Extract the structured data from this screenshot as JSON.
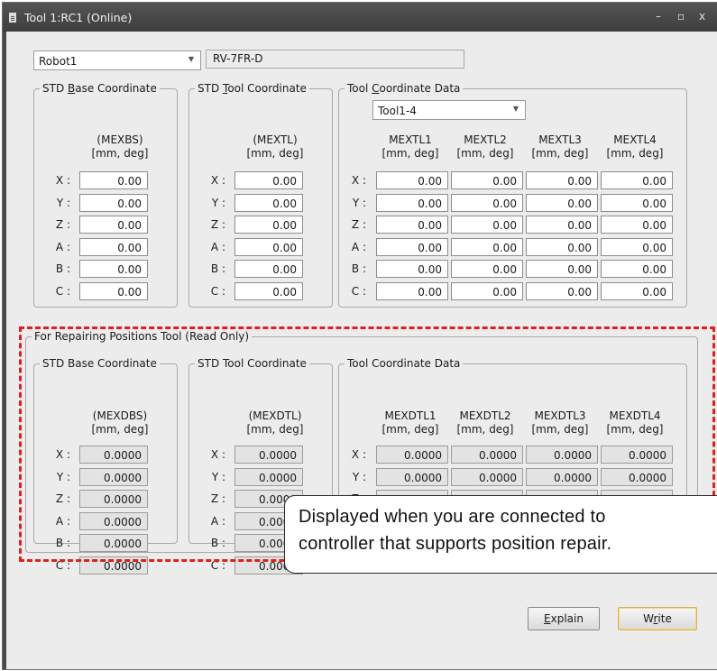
{
  "window": {
    "title": "Tool 1:RC1 (Online)",
    "minimize": "–",
    "maximize": "▫",
    "close": "x"
  },
  "robot_select": {
    "value": "Robot1",
    "model": "RV-7FR-D"
  },
  "std_base": {
    "group_pre": "STD ",
    "group_u": "B",
    "group_post": "ase Coordinate",
    "var": "(MEXBS)",
    "unit": "[mm, deg]",
    "rows": [
      {
        "axis": "X :",
        "value": "0.00"
      },
      {
        "axis": "Y :",
        "value": "0.00"
      },
      {
        "axis": "Z :",
        "value": "0.00"
      },
      {
        "axis": "A :",
        "value": "0.00"
      },
      {
        "axis": "B :",
        "value": "0.00"
      },
      {
        "axis": "C :",
        "value": "0.00"
      }
    ]
  },
  "std_tool": {
    "group_pre": "STD ",
    "group_u": "T",
    "group_post": "ool Coordinate",
    "var": "(MEXTL)",
    "unit": "[mm, deg]",
    "rows": [
      {
        "axis": "X :",
        "value": "0.00"
      },
      {
        "axis": "Y :",
        "value": "0.00"
      },
      {
        "axis": "Z :",
        "value": "0.00"
      },
      {
        "axis": "A :",
        "value": "0.00"
      },
      {
        "axis": "B :",
        "value": "0.00"
      },
      {
        "axis": "C :",
        "value": "0.00"
      }
    ]
  },
  "tool_data": {
    "group_pre": "Tool ",
    "group_u": "C",
    "group_post": "oordinate Data",
    "select_value": "Tool1-4",
    "columns": [
      {
        "name": "MEXTL1",
        "unit": "[mm, deg]"
      },
      {
        "name": "MEXTL2",
        "unit": "[mm, deg]"
      },
      {
        "name": "MEXTL3",
        "unit": "[mm, deg]"
      },
      {
        "name": "MEXTL4",
        "unit": "[mm, deg]"
      }
    ],
    "axes": [
      "X :",
      "Y :",
      "Z :",
      "A :",
      "B :",
      "C :"
    ],
    "values": [
      [
        "0.00",
        "0.00",
        "0.00",
        "0.00"
      ],
      [
        "0.00",
        "0.00",
        "0.00",
        "0.00"
      ],
      [
        "0.00",
        "0.00",
        "0.00",
        "0.00"
      ],
      [
        "0.00",
        "0.00",
        "0.00",
        "0.00"
      ],
      [
        "0.00",
        "0.00",
        "0.00",
        "0.00"
      ],
      [
        "0.00",
        "0.00",
        "0.00",
        "0.00"
      ]
    ]
  },
  "repair": {
    "title": "For Repairing Positions Tool (Read Only)",
    "std_base": {
      "group": "STD Base Coordinate",
      "var": "(MEXDBS)",
      "unit": "[mm, deg]",
      "rows": [
        {
          "axis": "X :",
          "value": "0.0000"
        },
        {
          "axis": "Y :",
          "value": "0.0000"
        },
        {
          "axis": "Z :",
          "value": "0.0000"
        },
        {
          "axis": "A :",
          "value": "0.0000"
        },
        {
          "axis": "B :",
          "value": "0.0000"
        },
        {
          "axis": "C :",
          "value": "0.0000"
        }
      ]
    },
    "std_tool": {
      "group": "STD Tool Coordinate",
      "var": "(MEXDTL)",
      "unit": "[mm, deg]",
      "rows": [
        {
          "axis": "X :",
          "value": "0.0000"
        },
        {
          "axis": "Y :",
          "value": "0.0000"
        },
        {
          "axis": "Z :",
          "value": "0.0000"
        },
        {
          "axis": "A :",
          "value": "0.0000"
        },
        {
          "axis": "B :",
          "value": "0.0000"
        },
        {
          "axis": "C :",
          "value": "0.0000"
        }
      ]
    },
    "tool_data": {
      "group": "Tool Coordinate Data",
      "columns": [
        {
          "name": "MEXDTL1",
          "unit": "[mm, deg]"
        },
        {
          "name": "MEXDTL2",
          "unit": "[mm, deg]"
        },
        {
          "name": "MEXDTL3",
          "unit": "[mm, deg]"
        },
        {
          "name": "MEXDTL4",
          "unit": "[mm, deg]"
        }
      ],
      "axes": [
        "X :",
        "Y :",
        "Z :"
      ],
      "values": [
        [
          "0.0000",
          "0.0000",
          "0.0000",
          "0.0000"
        ],
        [
          "0.0000",
          "0.0000",
          "0.0000",
          "0.0000"
        ],
        [
          "0.0000",
          "0.0000",
          "0.0000",
          "0.0000"
        ]
      ]
    }
  },
  "buttons": {
    "explain_u": "E",
    "explain_rest": "xplain",
    "write_pre": "W",
    "write_u": "r",
    "write_post": "ite"
  },
  "callout": {
    "line1": "Displayed when you are connected to",
    "line2": "controller that supports position repair."
  },
  "colors": {
    "titlebar": "#464646",
    "dialog_bg": "#ececec",
    "highlight_dash": "#e0201f"
  }
}
